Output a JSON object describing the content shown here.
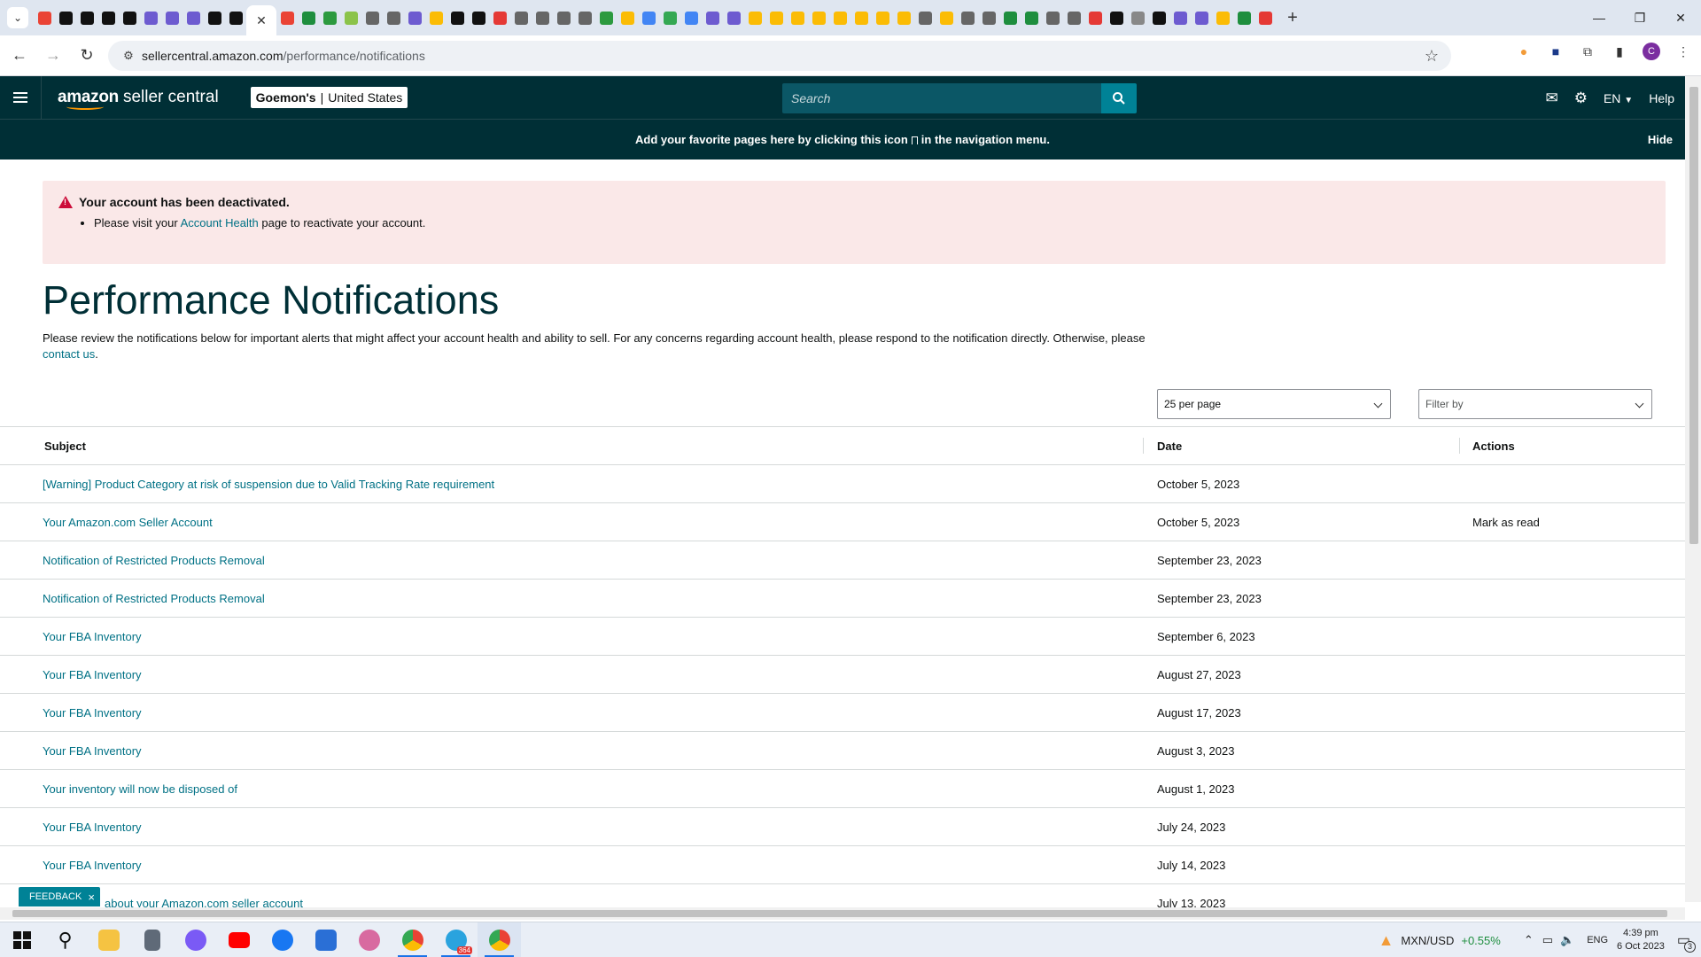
{
  "browser": {
    "url_host": "sellercentral.amazon.com",
    "url_path": "/performance/notifications",
    "active_tab_close": "✕",
    "new_tab": "+",
    "profile_initial": "C"
  },
  "header": {
    "logo_brand": "amazon",
    "logo_suffix": "seller central",
    "store_name": "Goemon's",
    "store_separator": "|",
    "store_region": "United States",
    "search_placeholder": "Search",
    "language": "EN",
    "help": "Help"
  },
  "favorites_bar": {
    "text_before": "Add your favorite pages here by clicking this icon",
    "text_after": "in the navigation menu.",
    "hide": "Hide"
  },
  "alert": {
    "title": "Your account has been deactivated.",
    "body_prefix": "Please visit your",
    "body_link": "Account Health",
    "body_suffix": "page to reactivate your account."
  },
  "page": {
    "title": "Performance Notifications",
    "description": "Please review the notifications below for important alerts that might affect your account health and ability to sell. For any concerns regarding account health, please respond to the notification directly. Otherwise, please",
    "contact_link": "contact us",
    "per_page": "25 per page",
    "filter_placeholder": "Filter by"
  },
  "table": {
    "headers": {
      "subject": "Subject",
      "date": "Date",
      "actions": "Actions"
    },
    "rows": [
      {
        "subject": "[Warning] Product Category at risk of suspension due to Valid Tracking Rate requirement",
        "date": "October 5, 2023",
        "action": ""
      },
      {
        "subject": "Your Amazon.com Seller Account",
        "date": "October 5, 2023",
        "action": "Mark as read"
      },
      {
        "subject": "Notification of Restricted Products Removal",
        "date": "September 23, 2023",
        "action": ""
      },
      {
        "subject": "Notification of Restricted Products Removal",
        "date": "September 23, 2023",
        "action": ""
      },
      {
        "subject": "Your FBA Inventory",
        "date": "September 6, 2023",
        "action": ""
      },
      {
        "subject": "Your FBA Inventory",
        "date": "August 27, 2023",
        "action": ""
      },
      {
        "subject": "Your FBA Inventory",
        "date": "August 17, 2023",
        "action": ""
      },
      {
        "subject": "Your FBA Inventory",
        "date": "August 3, 2023",
        "action": ""
      },
      {
        "subject": "Your inventory will now be disposed of",
        "date": "August 1, 2023",
        "action": ""
      },
      {
        "subject": "Your FBA Inventory",
        "date": "July 24, 2023",
        "action": ""
      },
      {
        "subject": "Your FBA Inventory",
        "date": "July 14, 2023",
        "action": ""
      },
      {
        "subject": "about your Amazon.com seller account",
        "date": "July 13, 2023",
        "action": ""
      }
    ]
  },
  "feedback": {
    "label": "FEEDBACK",
    "close": "×"
  },
  "taskbar": {
    "ticker_pair": "MXN/USD",
    "ticker_change": "+0.55%",
    "language": "ENG",
    "time": "4:39 pm",
    "date": "6 Oct 2023",
    "notifications_count": "3",
    "telegram_badge": "364"
  },
  "colors": {
    "header_bg": "#002f36",
    "link": "#007185",
    "alert_bg": "#fae8e8",
    "search_button": "#008296"
  }
}
